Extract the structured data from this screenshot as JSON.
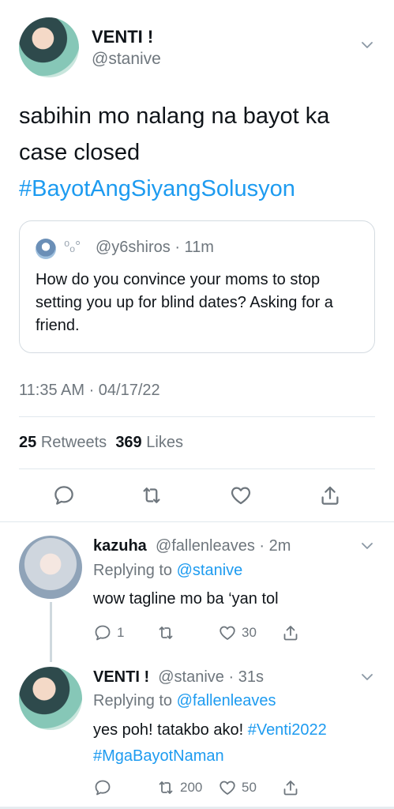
{
  "main_tweet": {
    "author_name": "VENTI !",
    "author_handle": "@stanive",
    "text_line1": "sabihin mo nalang na bayot ka",
    "text_line2": "case closed",
    "hashtag": "#BayotAngSiyangSolusyon",
    "quoted": {
      "badge": "⁰ₒ°",
      "handle_time": "@y6shiros · 11m",
      "text": "How do you convince your moms to stop setting you up for blind dates? Asking for a friend."
    },
    "timestamp": "11:35 AM · 04/17/22",
    "retweets_count": "25",
    "retweets_label": "Retweets",
    "likes_count": "369",
    "likes_label": "Likes"
  },
  "replies": [
    {
      "name": "kazuha",
      "handle_time": "@fallenleaves · 2m",
      "replying_prefix": "Replying to",
      "replying_to": "@stanive",
      "body_line1": "wow tagline mo ba ‘yan tol",
      "reply_count": "1",
      "retweet_count": "",
      "like_count": "30"
    },
    {
      "name": "VENTI !",
      "handle_time": "@stanive · 31s",
      "replying_prefix": "Replying to",
      "replying_to": "@fallenleaves",
      "body_text": "yes poh! tatakbo ako!",
      "body_hashtag1": "#Venti2022",
      "body_hashtag2": "#MgaBayotNaman",
      "reply_count": "",
      "retweet_count": "200",
      "like_count": "50"
    }
  ],
  "colors": {
    "accent": "#1d9bf0",
    "secondary_text": "#6e767d",
    "divider": "#e1e8ed"
  },
  "icons": [
    "chevron-down-icon",
    "reply-icon",
    "retweet-icon",
    "like-icon",
    "share-icon"
  ]
}
